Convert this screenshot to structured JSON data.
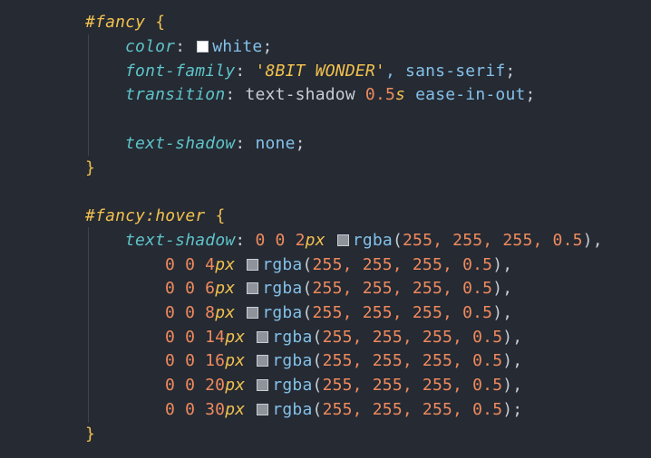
{
  "rule1": {
    "selector": "#fancy",
    "open": " {",
    "close": "}",
    "decls": {
      "color": {
        "prop": "color",
        "colon": ": ",
        "value": "white",
        "end": ";"
      },
      "font": {
        "prop": "font-family",
        "colon": ": ",
        "str": "'8BIT WONDER'",
        "rest": ", sans-serif",
        "end": ";"
      },
      "transition": {
        "prop": "transition",
        "colon": ": ",
        "plain": "text-shadow ",
        "num": "0.5",
        "unit": "s",
        "rest": " ease-in-out",
        "end": ";"
      },
      "shadow": {
        "prop": "text-shadow",
        "colon": ": ",
        "value": "none",
        "end": ";"
      }
    }
  },
  "rule2": {
    "selector": "#fancy:hover",
    "open": " {",
    "close": "}",
    "prop": "text-shadow",
    "colon": ": ",
    "shadows": [
      {
        "nums": "0 0 2",
        "unit": "px",
        "fn": "rgba",
        "args": "255, 255, 255, 0.5",
        "end": "),"
      },
      {
        "nums": "0 0 4",
        "unit": "px",
        "fn": "rgba",
        "args": "255, 255, 255, 0.5",
        "end": "),"
      },
      {
        "nums": "0 0 6",
        "unit": "px",
        "fn": "rgba",
        "args": "255, 255, 255, 0.5",
        "end": "),"
      },
      {
        "nums": "0 0 8",
        "unit": "px",
        "fn": "rgba",
        "args": "255, 255, 255, 0.5",
        "end": "),"
      },
      {
        "nums": "0 0 14",
        "unit": "px",
        "fn": "rgba",
        "args": "255, 255, 255, 0.5",
        "end": "),"
      },
      {
        "nums": "0 0 16",
        "unit": "px",
        "fn": "rgba",
        "args": "255, 255, 255, 0.5",
        "end": "),"
      },
      {
        "nums": "0 0 20",
        "unit": "px",
        "fn": "rgba",
        "args": "255, 255, 255, 0.5",
        "end": "),"
      },
      {
        "nums": "0 0 30",
        "unit": "px",
        "fn": "rgba",
        "args": "255, 255, 255, 0.5",
        "end": ");"
      }
    ]
  },
  "colors": {
    "background": "#252a33",
    "selector": "#f2c14e",
    "property": "#5fc4c9",
    "value": "#84c1e8",
    "number": "#f08a5d",
    "text": "#c7cdd6",
    "swatch_white": "#ffffff",
    "swatch_translucent": "#8f939a"
  }
}
